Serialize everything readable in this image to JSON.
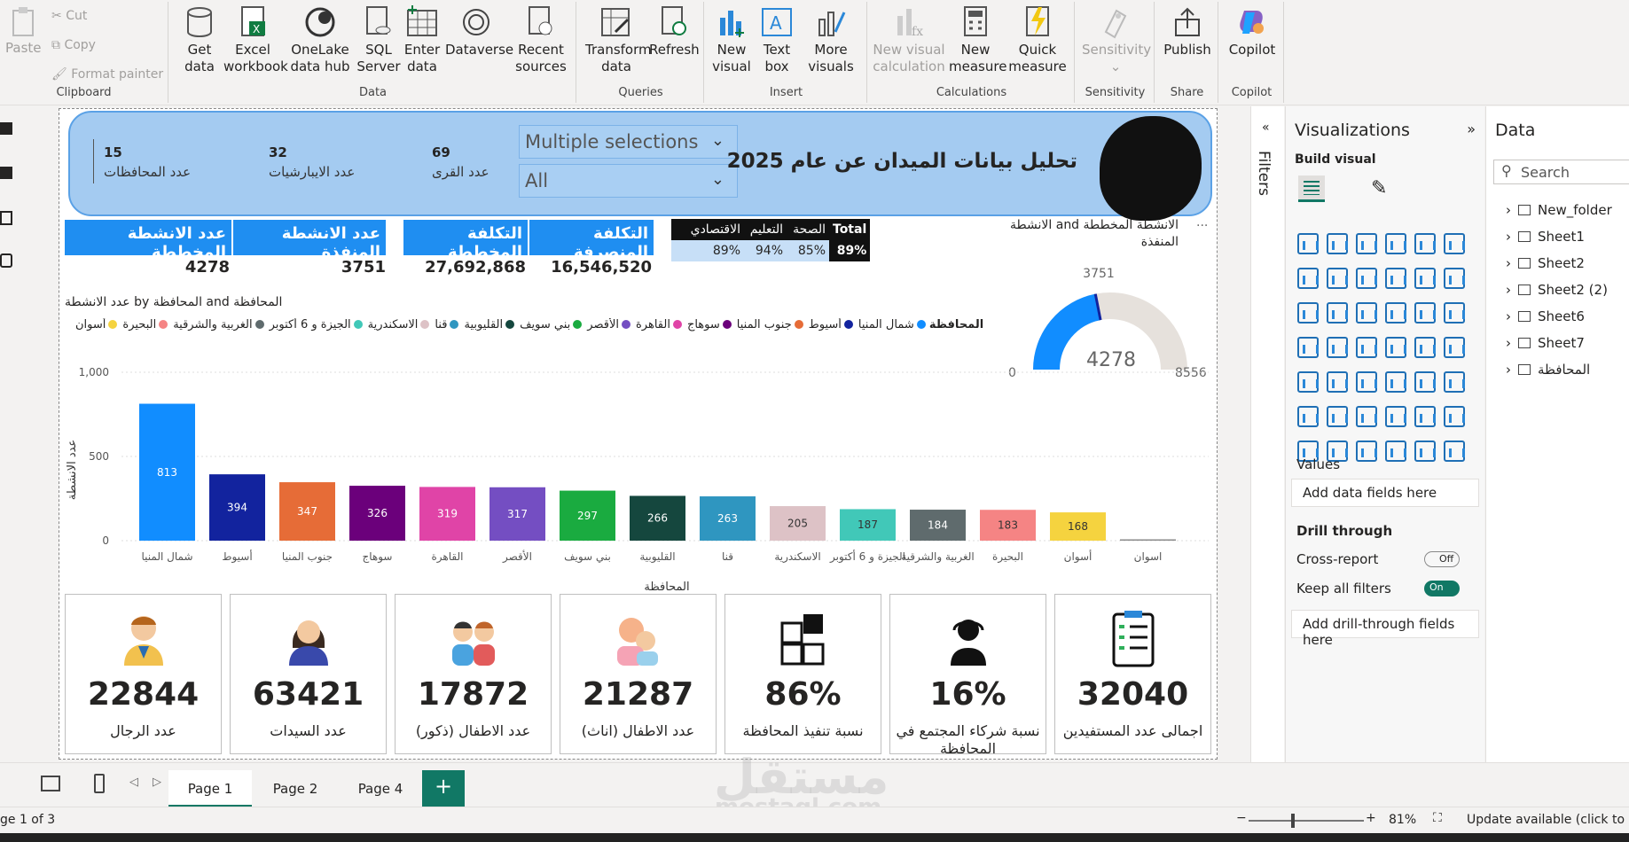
{
  "ribbon": {
    "clipboard": {
      "label": "Clipboard",
      "paste": "Paste",
      "cut": "Cut",
      "copy": "Copy",
      "format_painter": "Format painter"
    },
    "data": {
      "label": "Data",
      "get_data": "Get\ndata",
      "excel": "Excel\nworkbook",
      "onelake": "OneLake\ndata hub",
      "sql": "SQL\nServer",
      "enter": "Enter\ndata",
      "dataverse": "Dataverse",
      "recent": "Recent\nsources"
    },
    "queries": {
      "label": "Queries",
      "transform": "Transform\ndata",
      "refresh": "Refresh"
    },
    "insert": {
      "label": "Insert",
      "new_visual": "New\nvisual",
      "text_box": "Text\nbox",
      "more_visuals": "More\nvisuals"
    },
    "calculations": {
      "label": "Calculations",
      "new_visual_calc": "New visual\ncalculation",
      "new_measure": "New\nmeasure",
      "quick_measure": "Quick\nmeasure"
    },
    "sensitivity": {
      "label": "Sensitivity",
      "btn": "Sensitivity"
    },
    "share": {
      "label": "Share",
      "publish": "Publish"
    },
    "copilot": {
      "label": "Copilot",
      "btn": "Copilot"
    }
  },
  "report": {
    "title": "تحليل بيانات الميدان عن عام 2025",
    "kpis": [
      {
        "value": "15",
        "label": "عدد المحافظات"
      },
      {
        "value": "32",
        "label": "عدد الايبارشيات"
      },
      {
        "value": "69",
        "label": "عدد القرى"
      }
    ],
    "slicers": [
      "Multiple selections",
      "All"
    ],
    "cards": [
      {
        "label": "عدد الانشطة المخططة",
        "value": "4278"
      },
      {
        "label": "عدد الانشطة المنفذة",
        "value": "3751"
      },
      {
        "label": "التكلفة المخططة",
        "value": "27,692,868"
      },
      {
        "label": "التكلفة المنصرفة",
        "value": "16,546,520"
      }
    ],
    "matrix": {
      "headers": [
        "الاقتصادي",
        "التعليم",
        "الصحة",
        "Total"
      ],
      "values": [
        "89%",
        "94%",
        "85%",
        "89%"
      ]
    },
    "gauge": {
      "title": "الانشطة المخططة and الانشطة المنفذة",
      "value": "3751",
      "total": "4278",
      "min": "0",
      "max": "8556",
      "fraction": 0.4384
    },
    "bottom_cards": [
      {
        "value": "22844",
        "label": "عدد الرجال",
        "icon": "man-icon"
      },
      {
        "value": "63421",
        "label": "عدد السيدات",
        "icon": "woman-icon"
      },
      {
        "value": "17872",
        "label": "عدد الاطفال (ذكور)",
        "icon": "boys-icon"
      },
      {
        "value": "21287",
        "label": "عدد الاطفال (اناث)",
        "icon": "girls-icon"
      },
      {
        "value": "86%",
        "label": "نسبة تنفيذ المحافظة",
        "icon": "puzzle-icon"
      },
      {
        "value": "16%",
        "label": "نسبة شركاء المجتمع في المحافظة",
        "icon": "agent-icon"
      },
      {
        "value": "32040",
        "label": "اجمالى عدد المستفيدين",
        "icon": "checklist-icon"
      }
    ]
  },
  "chart_data": {
    "type": "bar",
    "title": "عدد الانشطة by المحافظة and المحافظة",
    "xlabel": "المحافظة",
    "ylabel": "عدد الانشطة",
    "legend_title": "المحافظة",
    "ylim": [
      0,
      1000
    ],
    "yticks": [
      "0",
      "500",
      "1,000"
    ],
    "categories": [
      "شمال المنيا",
      "أسيوط",
      "جنوب المنيا",
      "سوهاج",
      "القاهرة",
      "الأقصر",
      "بني سويف",
      "القليوبية",
      "قنا",
      "الاسكندرية",
      "الجيزة و 6 أكتوبر",
      "الغربية والشرقية",
      "البحيرة",
      "أسوان",
      "اسوان"
    ],
    "values": [
      813,
      394,
      347,
      326,
      319,
      317,
      297,
      266,
      263,
      205,
      187,
      184,
      183,
      168,
      5
    ],
    "labels": [
      "813",
      "394",
      "347",
      "326",
      "319",
      "317",
      "297",
      "266",
      "263",
      "205",
      "187",
      "184",
      "183",
      "168",
      ""
    ],
    "colors": [
      "#118dff",
      "#12239e",
      "#e66c37",
      "#6b007b",
      "#e044a7",
      "#744ec2",
      "#1aab40",
      "#15473e",
      "#2f96c0",
      "#ddc2c6",
      "#41c8b8",
      "#5f6b6d",
      "#f58484",
      "#f5d33f",
      "#8a8a8a"
    ]
  },
  "panes": {
    "filters": "Filters",
    "viz_title": "Visualizations",
    "build_visual": "Build visual",
    "values": "Values",
    "add_data": "Add data fields here",
    "drill": "Drill through",
    "cross": "Cross-report",
    "cross_state": "Off",
    "keep": "Keep all filters",
    "keep_state": "On",
    "add_drill": "Add drill-through fields here",
    "data_title": "Data",
    "search": "Search",
    "tables": [
      "New_folder",
      "Sheet1",
      "Sheet2",
      "Sheet2 (2)",
      "Sheet6",
      "Sheet7",
      "المحافظة"
    ]
  },
  "pages": {
    "tabs": [
      "Page 1",
      "Page 2",
      "Page 4"
    ],
    "add": "+",
    "status": "ge 1 of 3",
    "zoom": "81%",
    "update": "Update available (click to do"
  },
  "watermark": {
    "ar": "مستقل",
    "en": "mostaql.com"
  }
}
